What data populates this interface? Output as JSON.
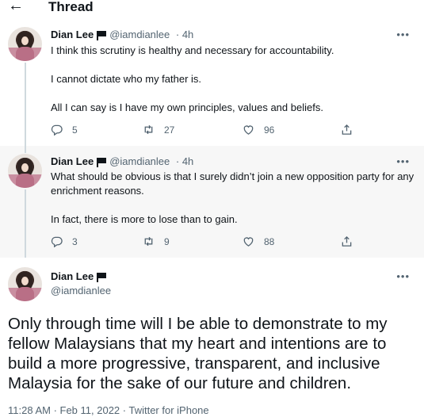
{
  "header": {
    "back_icon": "back-arrow-icon",
    "title": "Thread"
  },
  "tweets": [
    {
      "name": "Dian Lee",
      "handle": "@iamdianlee",
      "time": "4h",
      "more": "•••",
      "paragraphs": [
        "I think this scrutiny is healthy and necessary for accountability.",
        "I cannot dictate who my father is.",
        "All I can say is I have my own principles, values and beliefs."
      ],
      "replies": "5",
      "retweets": "27",
      "likes": "96"
    },
    {
      "name": "Dian Lee",
      "handle": "@iamdianlee",
      "time": "4h",
      "more": "•••",
      "paragraphs": [
        "What should be obvious is that I surely didn’t join a new opposition party for any enrichment reasons.",
        "In fact, there is more to lose than to gain."
      ],
      "replies": "3",
      "retweets": "9",
      "likes": "88"
    }
  ],
  "main_tweet": {
    "name": "Dian Lee",
    "handle": "@iamdianlee",
    "more": "•••",
    "text": "Only through time will I be able to demonstrate to my fellow Malaysians that my heart and intentions are to build a more progressive, transparent, and inclusive Malaysia for the sake of our future and children.",
    "timestamp": "11:28 AM · Feb 11, 2022 · Twitter for iPhone"
  },
  "colors": {
    "text": "#0f1419",
    "secondary": "#536471",
    "highlight_bg": "#f7f7f7"
  }
}
